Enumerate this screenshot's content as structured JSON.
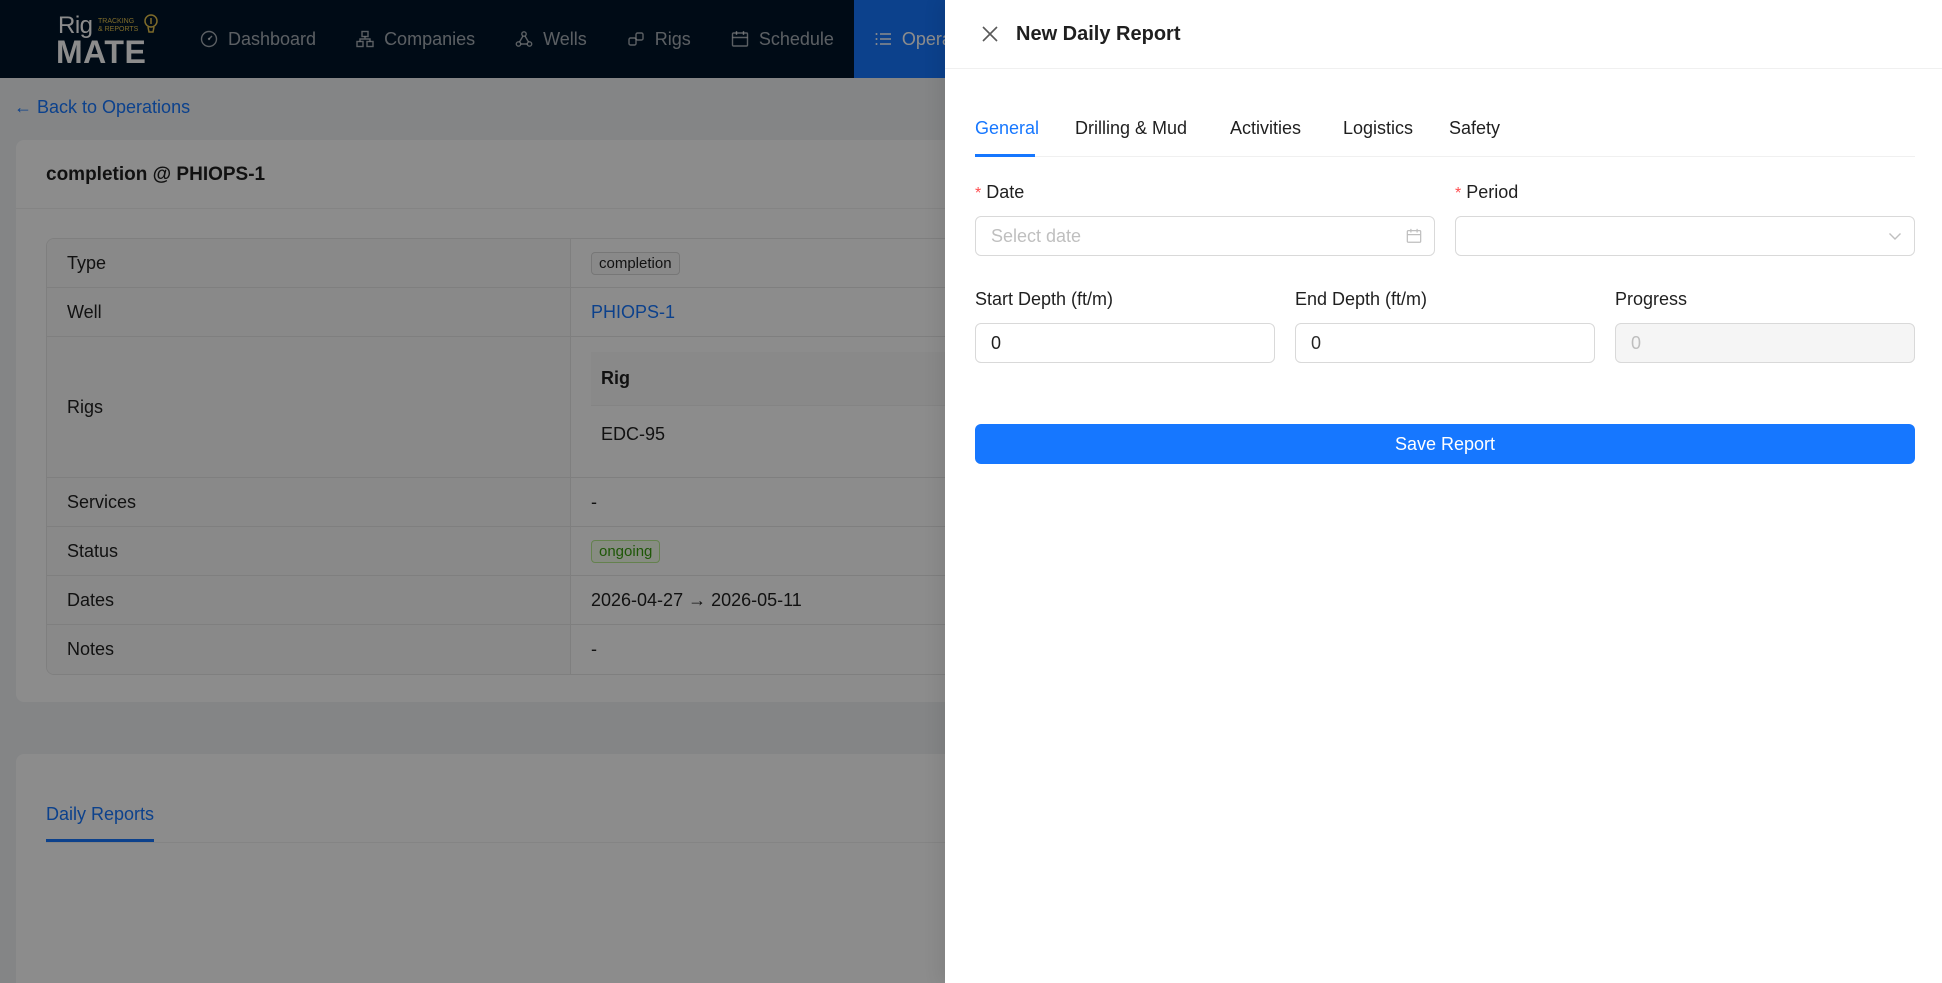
{
  "nav": {
    "logo": {
      "top": "Rig",
      "tagline_1": "TRACKING",
      "tagline_2": "& REPORTS",
      "bottom": "MATE"
    },
    "items": [
      {
        "label": "Dashboard",
        "icon": "dashboard-icon"
      },
      {
        "label": "Companies",
        "icon": "companies-icon"
      },
      {
        "label": "Wells",
        "icon": "wells-icon"
      },
      {
        "label": "Rigs",
        "icon": "rigs-icon"
      },
      {
        "label": "Schedule",
        "icon": "calendar-icon"
      },
      {
        "label": "Opera",
        "icon": "list-icon",
        "active": true
      }
    ]
  },
  "page": {
    "back_link": "← Back to Operations",
    "title": "completion @ PHIOPS-1",
    "details": {
      "type_label": "Type",
      "type_value": "completion",
      "well_label": "Well",
      "well_value": "PHIOPS-1",
      "rigs_label": "Rigs",
      "rigs_header": "Rig",
      "rigs_value": "EDC-95",
      "services_label": "Services",
      "services_value": "-",
      "status_label": "Status",
      "status_value": "ongoing",
      "dates_label": "Dates",
      "dates_value": "2026-04-27 → 2026-05-11",
      "notes_label": "Notes",
      "notes_value": "-"
    },
    "daily_reports_tab": "Daily Reports"
  },
  "drawer": {
    "title": "New Daily Report",
    "tabs": [
      "General",
      "Drilling & Mud",
      "Activities",
      "Logistics",
      "Safety"
    ],
    "active_tab": "General",
    "form": {
      "date_label": "Date",
      "date_placeholder": "Select date",
      "period_label": "Period",
      "period_value": "",
      "start_depth_label": "Start Depth (ft/m)",
      "start_depth_value": "0",
      "end_depth_label": "End Depth (ft/m)",
      "end_depth_value": "0",
      "progress_label": "Progress",
      "progress_value": "0"
    },
    "save_label": "Save Report"
  },
  "colors": {
    "primary": "#1677ff",
    "nav_bg": "#001529",
    "required": "#ff4d4f",
    "success": "#389e0d"
  }
}
